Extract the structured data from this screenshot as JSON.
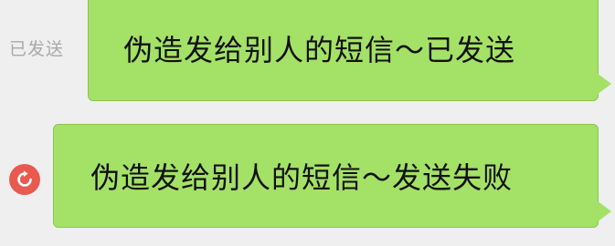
{
  "messages": [
    {
      "text": "伪造发给别人的短信～已发送",
      "status": "已发送"
    },
    {
      "text": "伪造发给别人的短信～发送失败",
      "status_icon": "resend-icon"
    }
  ],
  "colors": {
    "background": "#efefef",
    "bubble": "#a4e167",
    "bubble_border": "#89c64d",
    "status_text": "#a9a9a9",
    "fail_icon": "#e85a4f"
  }
}
